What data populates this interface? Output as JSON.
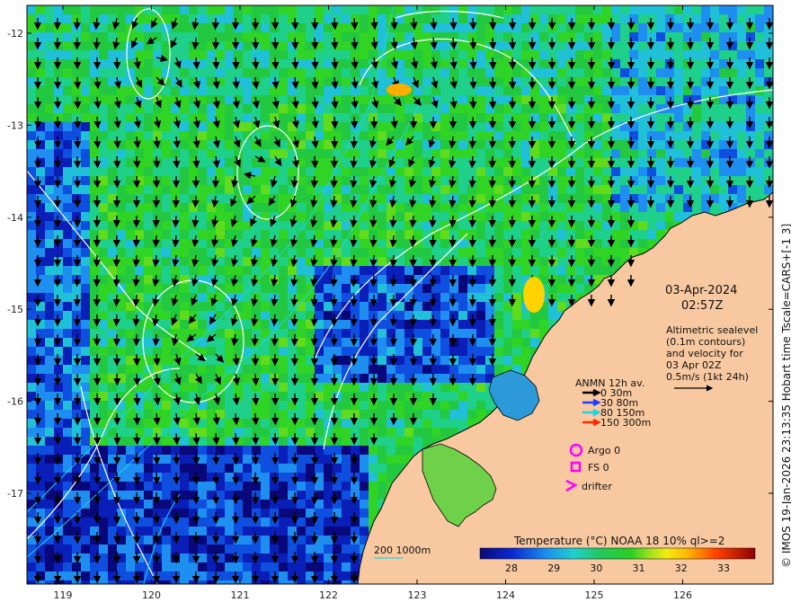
{
  "map": {
    "x_ticks": [
      "119",
      "120",
      "121",
      "122",
      "123",
      "124",
      "125",
      "126"
    ],
    "y_ticks": [
      "-12",
      "-13",
      "-14",
      "-15",
      "-16",
      "-17"
    ],
    "date": "03-Apr-2024",
    "time": "02:57Z",
    "info_lines": [
      "Altimetric sealevel",
      "(0.1m contours)",
      "and velocity for",
      "03 Apr 02Z",
      "0.5m/s (1kt 24h)"
    ],
    "legend_title": "ANMN 12h av.",
    "legend_items": [
      {
        "label": "0 30m",
        "color": "#000000"
      },
      {
        "label": "30 80m",
        "color": "#1e3cff"
      },
      {
        "label": "80 150m",
        "color": "#22d3e6"
      },
      {
        "label": "150 300m",
        "color": "#ff2a00"
      }
    ],
    "argo_label": "Argo 0",
    "fs_label": "FS 0",
    "drifter_label": "drifter",
    "isobath_label": "200  1000m",
    "colorbar_title": "Temperature (°C) NOAA 18 10% ql>=2",
    "colorbar_ticks": [
      "28",
      "29",
      "30",
      "31",
      "32",
      "33"
    ],
    "credit": "© IMOS 19-Jan-2026 23:13:35 Hobart time Tscale=CARS+[-1 3]",
    "colors": {
      "land": "#f8c9a0",
      "marker": "#ff00ff",
      "cyan": "#22d3e6",
      "sst_low": "#08088c",
      "sst_high": "#8c0000"
    }
  }
}
